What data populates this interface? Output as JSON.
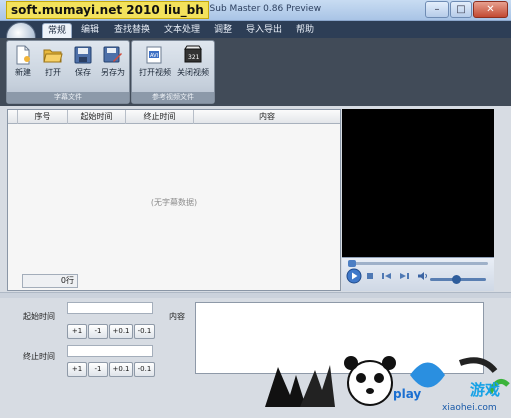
{
  "window": {
    "title": "SRT Sub Master 0.86 Preview",
    "overlay_watermark": "soft.mumayi.net 2010 liu_bh",
    "min_glyph": "–",
    "max_glyph": "□",
    "close_glyph": "✕"
  },
  "ribbon": {
    "tabs": [
      "常规",
      "编辑",
      "查找替换",
      "文本处理",
      "调整",
      "导入导出",
      "帮助"
    ],
    "active_tab": "常规",
    "groups": [
      {
        "label": "字幕文件",
        "buttons": [
          {
            "label": "新建",
            "icon": "new-file-icon"
          },
          {
            "label": "打开",
            "icon": "open-folder-icon"
          },
          {
            "label": "保存",
            "icon": "save-disk-icon"
          },
          {
            "label": "另存为",
            "icon": "save-as-icon"
          }
        ]
      },
      {
        "label": "参考视频文件",
        "buttons": [
          {
            "label": "打开视频",
            "icon": "open-video-icon"
          },
          {
            "label": "关闭视频",
            "icon": "close-video-icon"
          }
        ]
      }
    ]
  },
  "subtitle_table": {
    "columns": [
      "序号",
      "起始时间",
      "终止时间",
      "内容"
    ],
    "empty_message": "(无字幕数据)",
    "row_count": "0行"
  },
  "player": {
    "controls": [
      "play-icon",
      "stop-icon",
      "previous-icon",
      "next-icon",
      "volume-icon"
    ]
  },
  "editor": {
    "start_label": "起始时间",
    "end_label": "终止时间",
    "content_label": "内容",
    "start_buttons": [
      "+1",
      "-1",
      "+0.1",
      "-0.1"
    ],
    "end_buttons": [
      "+1",
      "-1",
      "+0.1",
      "-0.1"
    ]
  },
  "branding": {
    "site_text": "xiaohei.com",
    "game_text": "游戏",
    "play_text": "play"
  },
  "colors": {
    "titlebar": "#a9c4e6",
    "tab_strip": "#2d3e56",
    "ribbon_bg": "#414b58",
    "video_bg": "#000000",
    "watermark_bg": "#f3e25c"
  }
}
